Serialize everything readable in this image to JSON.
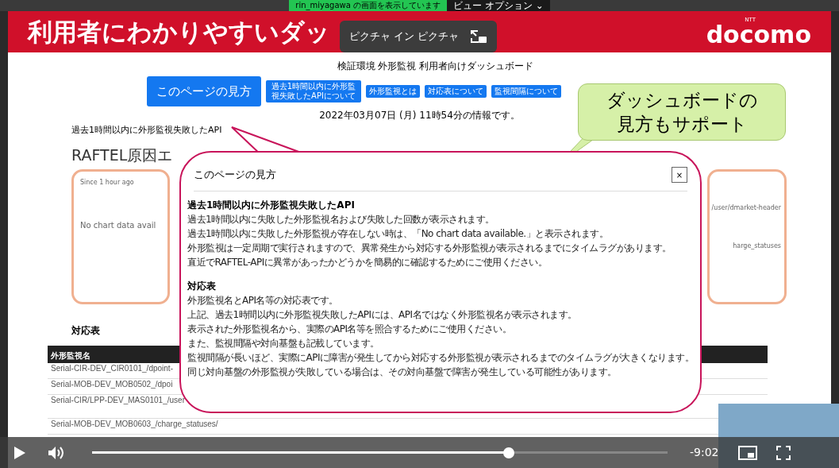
{
  "share_bar": {
    "label": "rin_miyagawa の画面を表示しています",
    "view_options": "ビュー オプション ⌄"
  },
  "slide": {
    "title": "利用者にわかりやすいダッ",
    "logo_small": "NTT",
    "logo": "docomo"
  },
  "pip_tooltip": {
    "label": "ピクチャ イン ピクチャ"
  },
  "dashboard": {
    "title": "検証環境 外形監視 利用者向けダッシュボード",
    "help_button": "このページの見方",
    "nav_buttons": [
      "過去1時間以内に外形監視失敗したAPIについて",
      "外形監視とは",
      "対応表について",
      "監視間隔について"
    ],
    "timestamp": "2022年03月07日 (月) 11時54分の情報です。",
    "failed_heading": "過去1時間以内に外形監視失敗したAPI",
    "error_heading": "RAFTEL原因エ",
    "chart_card": {
      "since": "Since 1 hour ago",
      "empty": "No chart data avail"
    },
    "side_card": {
      "lines": [
        "/user/dmarket-header",
        "harge_statuses"
      ]
    },
    "table_heading": "対応表",
    "table": {
      "columns": [
        "外形監視名"
      ],
      "rows": [
        "Serial-CIR-DEV_CIR0101_/dpoint-",
        "Serial-MOB-DEV_MOB0502_/dpoi",
        "Serial-CIR/LPP-DEV_MAS0101_/user",
        "Serial-MOB-DEV_MOB0603_/charge_statuses/"
      ]
    }
  },
  "callout": {
    "lines": [
      "ダッシュボードの",
      "見方もサポート"
    ]
  },
  "dialog": {
    "title": "このページの見方",
    "close": "×",
    "sections": [
      {
        "heading": "過去1時間以内に外形監視失敗したAPI",
        "lines": [
          "過去1時間以内に失敗した外形監視名および失敗した回数が表示されます。",
          "過去1時間以内に失敗した外形監視が存在しない時は、「No chart data available.」と表示されます。",
          "外形監視は一定周期で実行されますので、異常発生から対応する外形監視が表示されるまでにタイムラグがあります。",
          "直近でRAFTEL-APIに異常があったかどうかを簡易的に確認するためにご使用ください。"
        ]
      },
      {
        "heading": "対応表",
        "lines": [
          "外形監視名とAPI名等の対応表です。",
          "上記、過去1時間以内に外形監視失敗したAPIには、API名ではなく外形監視名が表示されます。",
          "表示された外形監視名から、実際のAPI名等を照合するためにご使用ください。",
          "また、監視間隔や対向基盤も記載しています。",
          "監視間隔が長いほど、実際にAPIに障害が発生してから対応する外形監視が表示されるまでのタイムラグが大きくなります。",
          "同じ対向基盤の外形監視が失敗している場合は、その対向基盤で障害が発生している可能性があります。"
        ]
      }
    ]
  },
  "player": {
    "playing": false,
    "level": 0.724,
    "remaining": "-9:02"
  }
}
